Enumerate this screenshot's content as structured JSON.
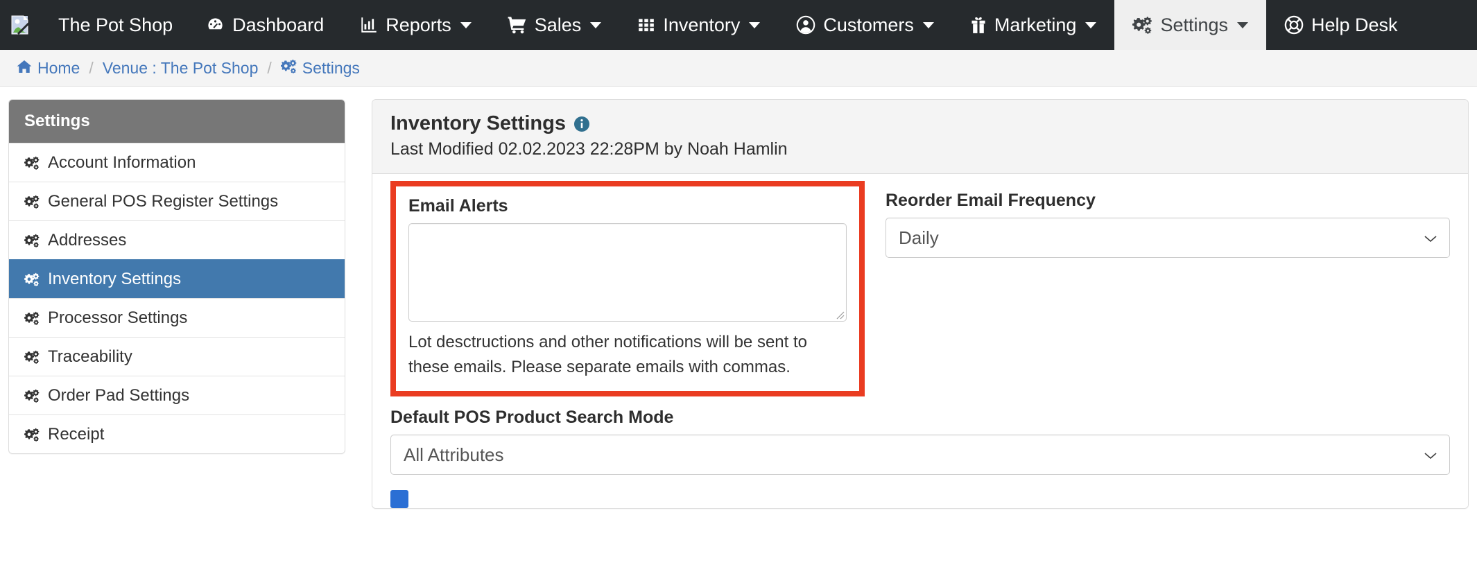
{
  "navbar": {
    "logo_alt": "broken-image",
    "brand": "The Pot Shop",
    "items": [
      {
        "label": "Dashboard",
        "icon": "dashboard-icon",
        "caret": false,
        "active": false
      },
      {
        "label": "Reports",
        "icon": "bar-chart-icon",
        "caret": true,
        "active": false
      },
      {
        "label": "Sales",
        "icon": "cart-icon",
        "caret": true,
        "active": false
      },
      {
        "label": "Inventory",
        "icon": "grid-icon",
        "caret": true,
        "active": false
      },
      {
        "label": "Customers",
        "icon": "user-circle-icon",
        "caret": true,
        "active": false
      },
      {
        "label": "Marketing",
        "icon": "gift-icon",
        "caret": true,
        "active": false
      },
      {
        "label": "Settings",
        "icon": "cogs-icon",
        "caret": true,
        "active": true
      },
      {
        "label": "Help Desk",
        "icon": "lifering-icon",
        "caret": false,
        "active": false
      }
    ]
  },
  "breadcrumb": {
    "home": "Home",
    "venue": "Venue : The Pot Shop",
    "current": "Settings",
    "separator": "/"
  },
  "sidebar": {
    "header": "Settings",
    "items": [
      {
        "label": "Account Information",
        "active": false
      },
      {
        "label": "General POS Register Settings",
        "active": false
      },
      {
        "label": "Addresses",
        "active": false
      },
      {
        "label": "Inventory Settings",
        "active": true
      },
      {
        "label": "Processor Settings",
        "active": false
      },
      {
        "label": "Traceability",
        "active": false
      },
      {
        "label": "Order Pad Settings",
        "active": false
      },
      {
        "label": "Receipt",
        "active": false
      }
    ]
  },
  "main": {
    "title": "Inventory Settings",
    "info_icon": "info-circle-icon",
    "last_modified": "Last Modified 02.02.2023 22:28PM by Noah Hamlin",
    "email_alerts": {
      "label": "Email Alerts",
      "value": "",
      "placeholder": "",
      "help": "Lot desctructions and other notifications will be sent to these emails. Please separate emails with commas.",
      "highlight_color": "#ea3c21"
    },
    "reorder_frequency": {
      "label": "Reorder Email Frequency",
      "value": "Daily",
      "options": [
        "Daily"
      ]
    },
    "search_mode": {
      "label": "Default POS Product Search Mode",
      "value": "All Attributes",
      "options": [
        "All Attributes"
      ]
    },
    "bottom_checkbox": {
      "checked": true,
      "label": ""
    }
  },
  "colors": {
    "navbar_bg": "#262a2d",
    "nav_active_bg": "#efefef",
    "breadcrumb_bg": "#f4f4f4",
    "link_blue": "#4477bb",
    "sidebar_header_bg": "#777777",
    "sidebar_active_bg": "#4279ad",
    "card_head_bg": "#f4f4f4",
    "highlight_red": "#ea3c21"
  }
}
